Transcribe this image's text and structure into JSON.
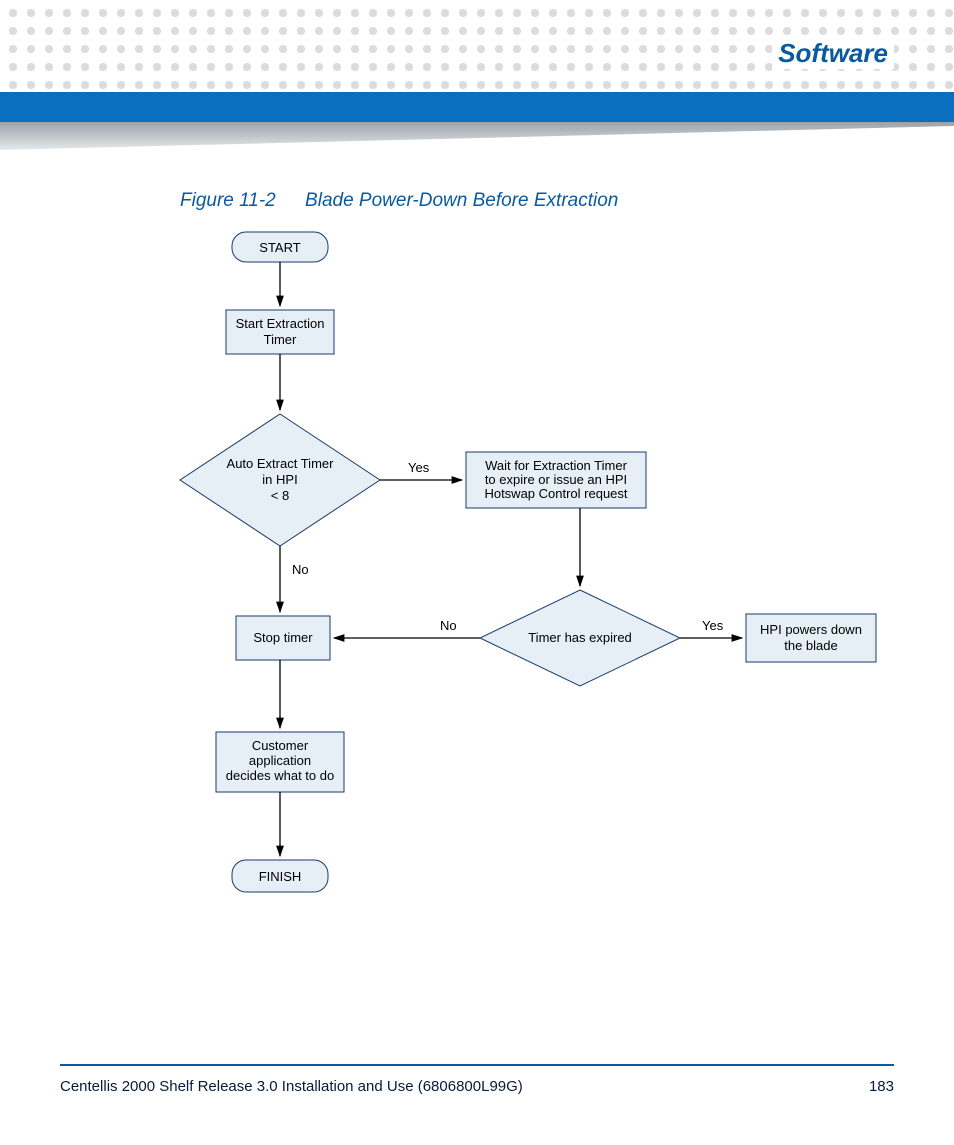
{
  "header": {
    "section_title": "Software"
  },
  "figure": {
    "label": "Figure 11-2",
    "title": "Blade Power-Down Before Extraction"
  },
  "flowchart": {
    "start": "START",
    "step1": "Start Extraction Timer",
    "decision1_l1": "Auto Extract Timer",
    "decision1_l2": "in HPI",
    "decision1_l3": "< 8",
    "d1_yes": "Yes",
    "d1_no": "No",
    "step2_l1": "Wait for Extraction Timer",
    "step2_l2": "to expire or issue an HPI",
    "step2_l3": "Hotswap Control request",
    "decision2": "Timer has expired",
    "d2_yes": "Yes",
    "d2_no": "No",
    "step3": "Stop timer",
    "step4_l1": "HPI powers down",
    "step4_l2": "the blade",
    "step5_l1": "Customer",
    "step5_l2": "application",
    "step5_l3": "decides what to do",
    "finish": "FINISH"
  },
  "footer": {
    "doc_title": "Centellis 2000 Shelf Release 3.0 Installation and Use (6806800L99G)",
    "page": "183"
  },
  "colors": {
    "node_fill": "#e6eef6",
    "node_stroke": "#1a3a6a",
    "brand_blue": "#0a5aa0"
  }
}
